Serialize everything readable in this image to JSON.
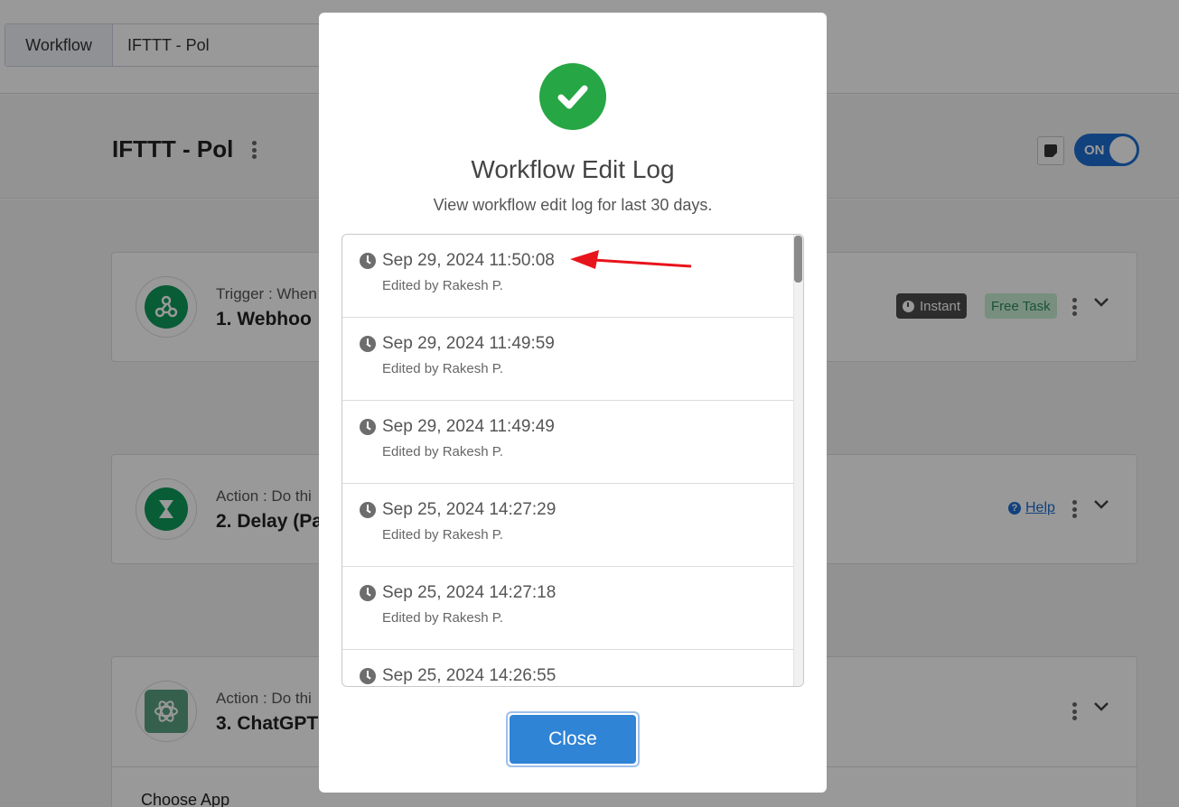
{
  "topbar": {
    "tabs": [
      {
        "label": "Workflow"
      },
      {
        "label": "IFTTT - Pol"
      }
    ]
  },
  "header": {
    "title": "IFTTT - Pol",
    "toggle_label": "ON"
  },
  "steps": [
    {
      "kind": "Trigger : When",
      "title": "1. Webhoo",
      "badges": [
        "Instant",
        "Free Task"
      ],
      "icon": "webhook-icon"
    },
    {
      "kind": "Action : Do thi",
      "title": "2. Delay (Pa",
      "help_label": "Help",
      "icon": "hourglass-icon"
    },
    {
      "kind": "Action : Do thi",
      "title": "3. ChatGPT",
      "icon": "openai-icon",
      "section_label": "Choose App"
    }
  ],
  "modal": {
    "title": "Workflow Edit Log",
    "subtitle": "View workflow edit log for last 30 days.",
    "entries": [
      {
        "timestamp": "Sep 29, 2024 11:50:08",
        "editor": "Edited by Rakesh P."
      },
      {
        "timestamp": "Sep 29, 2024 11:49:59",
        "editor": "Edited by Rakesh P."
      },
      {
        "timestamp": "Sep 29, 2024 11:49:49",
        "editor": "Edited by Rakesh P."
      },
      {
        "timestamp": "Sep 25, 2024 14:27:29",
        "editor": "Edited by Rakesh P."
      },
      {
        "timestamp": "Sep 25, 2024 14:27:18",
        "editor": "Edited by Rakesh P."
      },
      {
        "timestamp": "Sep 25, 2024 14:26:55",
        "editor": ""
      }
    ],
    "close_label": "Close"
  },
  "colors": {
    "success": "#26a644",
    "primary": "#2f84d6",
    "toggle": "#1f6fd1",
    "annotation_arrow": "#e8141b"
  }
}
